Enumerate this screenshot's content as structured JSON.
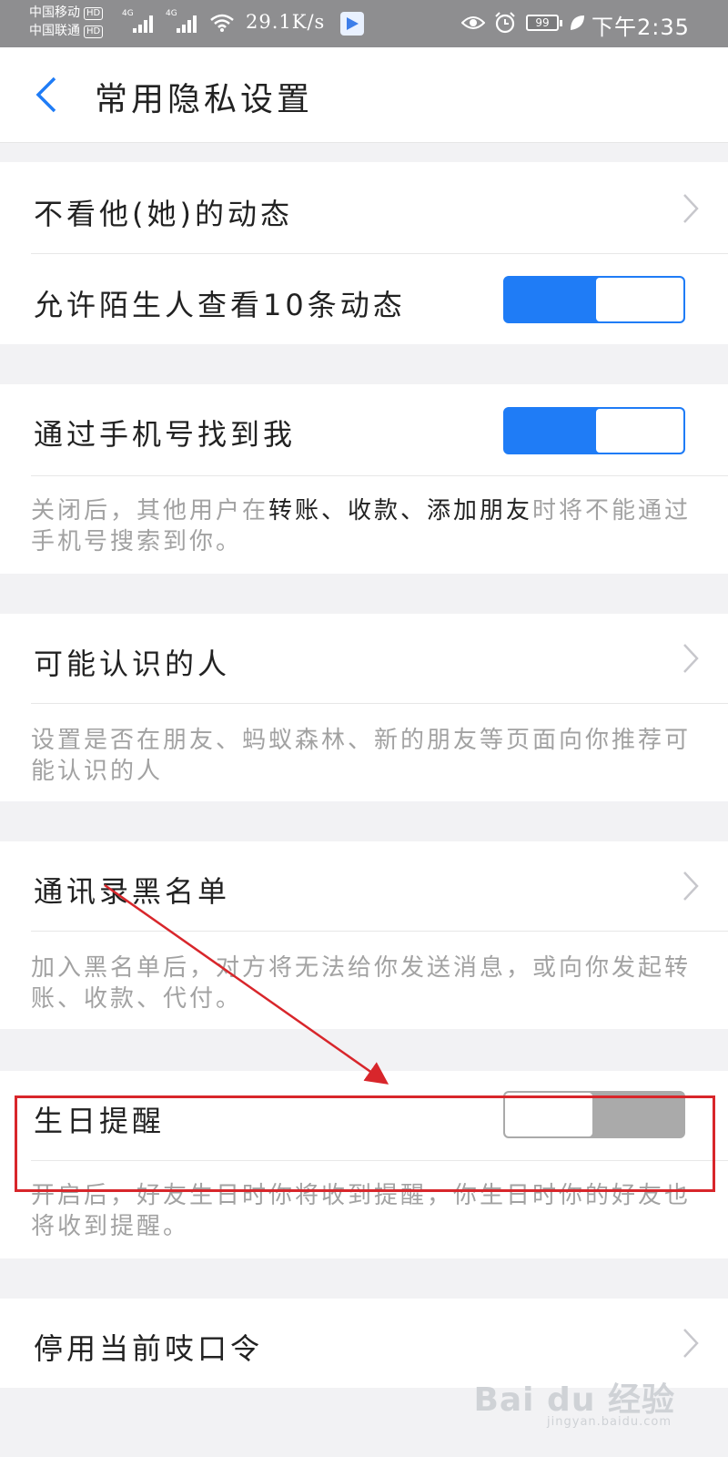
{
  "status_bar": {
    "carrier_1": "中国移动",
    "carrier_2": "中国联通",
    "hd_badge": "HD",
    "network_label": "4G",
    "speed": "29.1K/s",
    "battery": "99",
    "time": "下午2:35"
  },
  "nav": {
    "title": "常用隐私设置",
    "back_icon": "chevron-left-icon"
  },
  "rows": {
    "hide_moments": {
      "label": "不看他(她)的动态"
    },
    "stranger_view": {
      "label": "允许陌生人查看10条动态",
      "toggle": "on"
    },
    "find_by_phone": {
      "label": "通过手机号找到我",
      "toggle": "on",
      "desc_pre": "关闭后，其他用户在",
      "desc_bold": "转账、收款、添加朋友",
      "desc_post": "时将不能通过手机号搜索到你。"
    },
    "people_may_know": {
      "label": "可能认识的人",
      "desc": "设置是否在朋友、蚂蚁森林、新的朋友等页面向你推荐可能认识的人"
    },
    "contacts_blacklist": {
      "label": "通讯录黑名单",
      "desc": "加入黑名单后，对方将无法给你发送消息，或向你发起转账、收款、代付。"
    },
    "birthday_reminder": {
      "label": "生日提醒",
      "toggle": "off",
      "desc": "开启后，好友生日时你将收到提醒，你生日时你的好友也将收到提醒。"
    },
    "disable_password": {
      "label": "停用当前吱口令"
    }
  },
  "colors": {
    "accent": "#1f7cf6",
    "toggle_off": "#aaaaaa",
    "annotation_red": "#d8262b",
    "page_bg": "#f2f2f4",
    "status_bar_bg": "#8e8e90"
  },
  "watermark": {
    "main": "Bai du 经验",
    "sub": "jingyan.baidu.com"
  }
}
